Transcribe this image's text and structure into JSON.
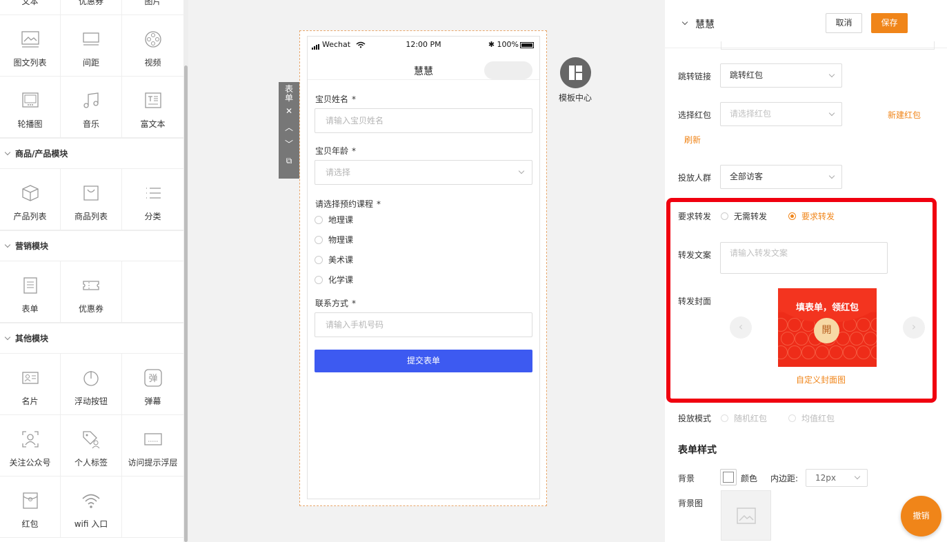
{
  "left": {
    "top_row": [
      "文本",
      "优惠券",
      "图片"
    ],
    "basic": [
      "图文列表",
      "间距",
      "视频",
      "轮播图",
      "音乐",
      "富文本"
    ],
    "sections": [
      {
        "title": "商品/产品模块",
        "items": [
          "产品列表",
          "商品列表",
          "分类"
        ]
      },
      {
        "title": "营销模块",
        "items": [
          "表单",
          "优惠券"
        ]
      },
      {
        "title": "其他模块",
        "items": [
          "名片",
          "浮动按钮",
          "弹幕",
          "关注公众号",
          "个人标签",
          "访问提示浮层",
          "红包",
          "wifi 入口"
        ]
      }
    ]
  },
  "toolbar": {
    "label": "表单",
    "close": "✕",
    "up": "︿",
    "down": "﹀",
    "copy": "⧉"
  },
  "phone": {
    "carrier": "Wechat",
    "time": "12:00 PM",
    "battery": "100%",
    "title": "慧慧",
    "fields": {
      "name_label": "宝贝姓名",
      "name_placeholder": "请输入宝贝姓名",
      "age_label": "宝贝年龄",
      "age_placeholder": "请选择",
      "course_label": "请选择预约课程",
      "courses": [
        "地理课",
        "物理课",
        "美术课",
        "化学课"
      ],
      "contact_label": "联系方式",
      "contact_placeholder": "请输入手机号码",
      "required_mark": "*"
    },
    "submit": "提交表单"
  },
  "template_center": "模板中心",
  "settings": {
    "title": "慧慧",
    "cancel": "取消",
    "save": "保存",
    "jump_link_label": "跳转链接",
    "jump_link_value": "跳转红包",
    "select_redpacket_label": "选择红包",
    "select_redpacket_placeholder": "请选择红包",
    "new_redpacket": "新建红包",
    "refresh": "刷新",
    "audience_label": "投放人群",
    "audience_value": "全部访客",
    "forward_label": "要求转发",
    "forward_no": "无需转发",
    "forward_yes": "要求转发",
    "forward_text_label": "转发文案",
    "forward_text_placeholder": "请输入转发文案",
    "forward_cover_label": "转发封面",
    "cover_title": "填表单，领红包",
    "cover_open": "開",
    "custom_cover": "自定义封面图",
    "mode_label": "投放模式",
    "mode_random": "随机红包",
    "mode_equal": "均值红包",
    "style_title": "表单样式",
    "bg_label": "背景",
    "color_label": "颜色",
    "padding_label": "内边距:",
    "padding_value": "12px",
    "bg_image_label": "背景图"
  },
  "undo": "撤销",
  "colors": {
    "accent": "#f08519",
    "primary_blue": "#3d5af1",
    "highlight_red": "#f0000f"
  }
}
